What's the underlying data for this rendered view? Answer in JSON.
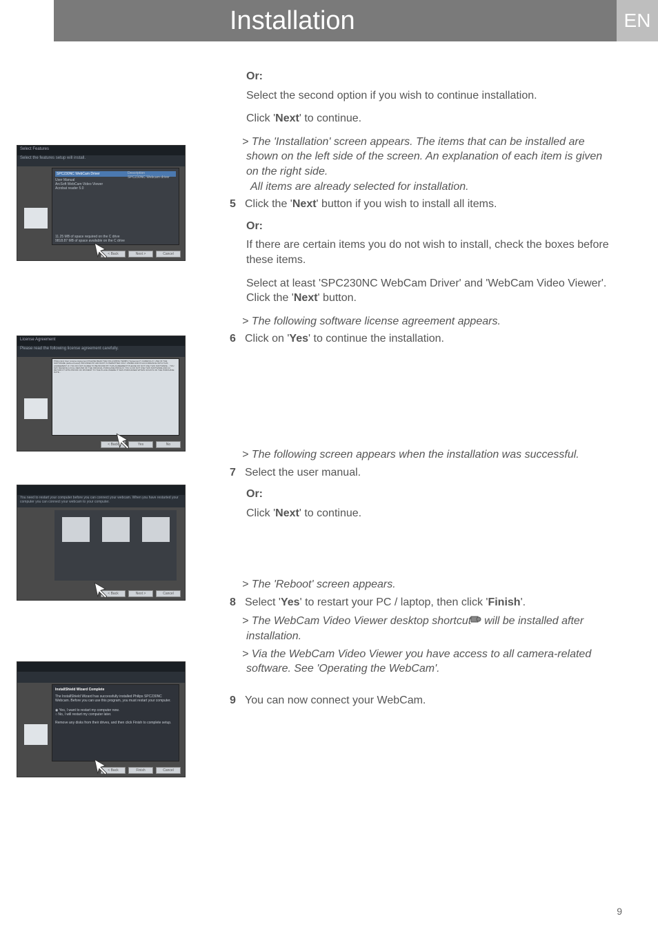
{
  "header": {
    "title": "Installation",
    "lang": "EN"
  },
  "or": "Or:",
  "top": {
    "select_second": "Select the second option if you wish to continue installation.",
    "click_next": "Click '",
    "next": "Next",
    "to_continue": "' to continue."
  },
  "step5": {
    "result_line1": "The 'Installation' screen appears. The items that can be installed are shown on the left side of the screen. An explanation of each item is given on the right side.",
    "result_line2": "All items are already selected for installation.",
    "num": "5",
    "text1": "Click the '",
    "text2": "' button if you wish to install all items.",
    "or_text1": "If there are certain items you do not wish to install, check the boxes before these items.",
    "or_text2_a": "Select at least 'SPC230NC WebCam Driver' and 'WebCam Video Viewer'. Click the '",
    "or_text2_b": "' button."
  },
  "step6": {
    "result": "The following software license agreement appears.",
    "num": "6",
    "text_a": "Click on '",
    "yes": "Yes",
    "text_b": "' to continue the installation."
  },
  "step7": {
    "result": "The following screen appears when the installation was successful.",
    "num": "7",
    "text": "Select the user manual.",
    "or_a": "Click '",
    "or_b": "' to continue."
  },
  "step8": {
    "result": "The 'Reboot' screen appears.",
    "num": "8",
    "text_a": "Select '",
    "text_b": "' to restart your PC / laptop, then click '",
    "finish": "Finish",
    "text_c": "'.",
    "sub1_a": "The WebCam Video Viewer desktop shortcut ",
    "sub1_b": " will be installed after installation.",
    "sub2": "Via the WebCam Video Viewer you have access to all camera-related software. See 'Operating the WebCam'."
  },
  "step9": {
    "num": "9",
    "text": "You can now connect your WebCam."
  },
  "shots": {
    "s1_hdr": "Select Features",
    "s1_sub": "Select the features setup will install.",
    "s1_list1": "SPC230NC WebCam Driver",
    "s1_list2": "User Manual",
    "s1_list3": "ArcSoft WebCam Video Viewer",
    "s1_list4": "Acrobat reader 5.0",
    "s1_desc": "Description",
    "s1_desc2": "SPC230NC Webcam driver",
    "s1_space": "11.25 MB of space required on the C drive\n9818.87 MB of space available on the C drive",
    "s2_hdr": "License Agreement",
    "s2_sub": "Please read the following license agreement carefully.",
    "s3_hdr": "",
    "s4_hdr": "InstallShield Wizard Complete",
    "btn_back": "< Back",
    "btn_next": "Next >",
    "btn_cancel": "Cancel",
    "btn_yes": "Yes",
    "btn_no": "No",
    "btn_finish": "Finish"
  },
  "page_number": "9"
}
